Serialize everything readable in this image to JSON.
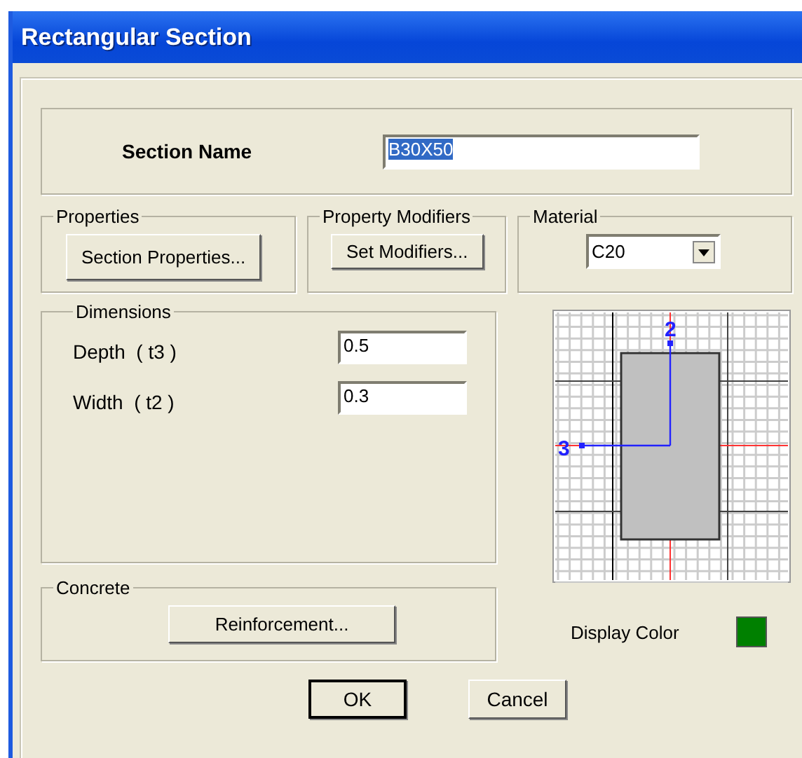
{
  "window": {
    "title": "Rectangular Section"
  },
  "section_name": {
    "label": "Section Name",
    "value": "B30X50",
    "text_selected": true
  },
  "properties": {
    "label": "Properties",
    "button": "Section Properties..."
  },
  "property_modifiers": {
    "label": "Property Modifiers",
    "button": "Set Modifiers..."
  },
  "material": {
    "label": "Material",
    "value": "C20"
  },
  "dimensions": {
    "label": "Dimensions",
    "fields": [
      {
        "label": "Depth  ( t3 )",
        "value": "0.5"
      },
      {
        "label": "Width  ( t2 )",
        "value": "0.3"
      }
    ]
  },
  "concrete": {
    "label": "Concrete",
    "button": "Reinforcement..."
  },
  "preview": {
    "axis_labels": [
      "2",
      "3"
    ]
  },
  "display_color": {
    "label": "Display Color",
    "color": "#008000"
  },
  "buttons": [
    "OK",
    "Cancel"
  ]
}
